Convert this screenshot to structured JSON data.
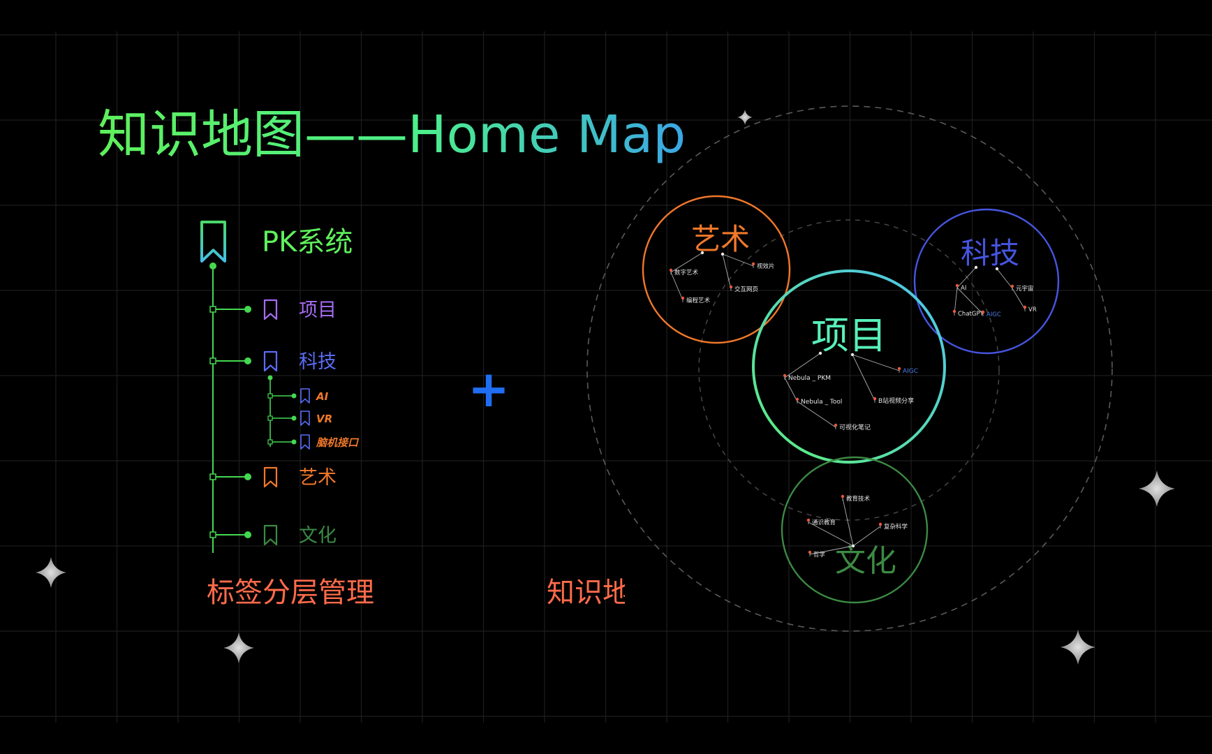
{
  "title": {
    "main": "知识地图——Home Map"
  },
  "tree": {
    "root": "PK系统",
    "items": [
      {
        "label": "项目",
        "color": "#a66cf2"
      },
      {
        "label": "科技",
        "color": "#5a6cf5",
        "children": [
          {
            "label": "AI",
            "color": "#f0782a"
          },
          {
            "label": "VR",
            "color": "#f0782a"
          },
          {
            "label": "脑机接口",
            "color": "#f0782a"
          }
        ]
      },
      {
        "label": "艺术",
        "color": "#f0782a"
      },
      {
        "label": "文化",
        "color": "#3c8a43"
      }
    ],
    "caption": "标签分层管理"
  },
  "plus": {
    "symbol": "+"
  },
  "map_caption": "知识地",
  "clusters": [
    {
      "name": "艺术",
      "color": "#f0782a",
      "nodes": [
        "数字艺术",
        "视效片",
        "编程艺术",
        "交互网页"
      ]
    },
    {
      "name": "科技",
      "color": "#4655e0",
      "nodes": [
        "AI",
        "元宇宙",
        "ChatGPT",
        "AIGC",
        "VR"
      ]
    },
    {
      "name": "项目",
      "color": "#58f0b8",
      "nodes": [
        "Nebula _ PKM",
        "AIGC",
        "Nebula _ Tool",
        "B站视频分享",
        "可视化笔记"
      ]
    },
    {
      "name": "文化",
      "color": "#3c8a43",
      "nodes": [
        "教育技术",
        "通识教育",
        "复杂科学",
        "哲学"
      ]
    }
  ],
  "colors": {
    "background": "#000000",
    "grid": "#1e1e1e",
    "tree_line": "#44d850",
    "caption": "#ff6b4a",
    "plus": "#1f6df2",
    "title_start": "#5ff05c",
    "title_end": "#3aa6e6",
    "sparkle": "#bdbdbd"
  },
  "icons": [
    "bookmark-icon",
    "sparkle-icon",
    "plus-icon"
  ]
}
